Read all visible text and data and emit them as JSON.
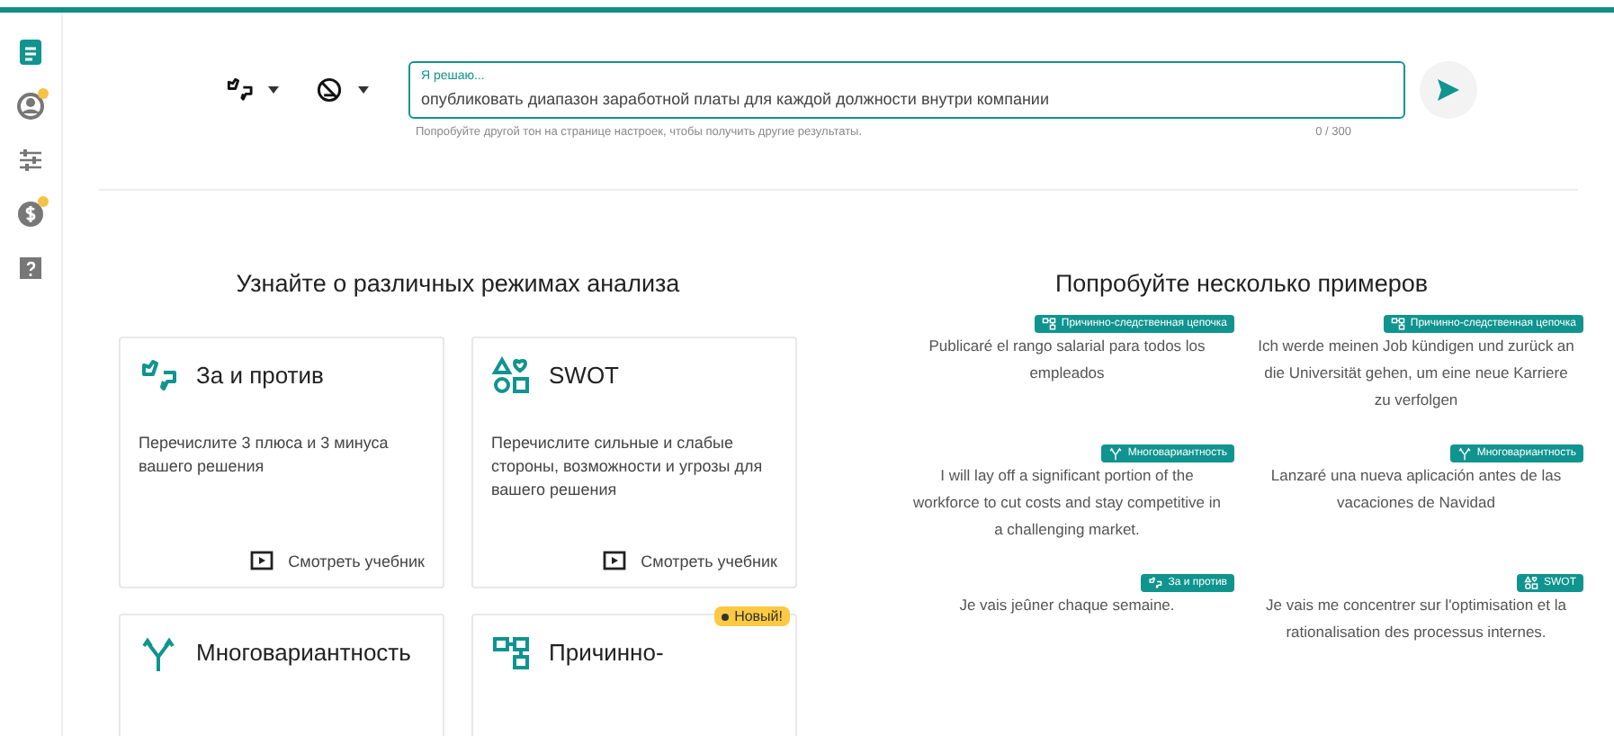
{
  "sidebar": {
    "items": [
      {
        "kind": "document",
        "selected": true,
        "alert": false
      },
      {
        "kind": "person",
        "selected": false,
        "alert": true
      },
      {
        "kind": "sliders",
        "selected": false,
        "alert": false
      },
      {
        "kind": "dollar",
        "selected": false,
        "alert": true
      },
      {
        "kind": "help",
        "selected": false,
        "alert": false
      }
    ]
  },
  "toolbar": {
    "selectors": [
      {
        "kind": "pros-cons"
      },
      {
        "kind": "tone"
      }
    ]
  },
  "decision_field": {
    "label": "Я решаю...",
    "value": "опубликовать диапазон заработной платы для каждой должности внутри компании",
    "hint": "Попробуйте другой тон на странице настроек, чтобы получить другие результаты.",
    "counter": "0 / 300"
  },
  "modes": {
    "title": "Узнайте о различных режимах анализа",
    "cards": [
      {
        "kind": "pros-cons",
        "title": "За и против",
        "description": "Перечислите 3 плюса и 3 минуса вашего решения",
        "tutorial_link": "Смотреть учебник"
      },
      {
        "kind": "swot",
        "title": "SWOT",
        "description": "Перечислите сильные и слабые стороны, возможности и угрозы для вашего решения",
        "tutorial_link": "Смотреть учебник"
      },
      {
        "kind": "multi",
        "title": "Многовариантность"
      },
      {
        "kind": "causal",
        "title": "Причинно-",
        "badge": "Новый!"
      }
    ]
  },
  "examples": {
    "title": "Попробуйте несколько примеров",
    "items": [
      {
        "tag": {
          "kind": "causal",
          "label": "Причинно-следственная цепочка"
        },
        "text": "Publicaré el rango salarial para todos los empleados"
      },
      {
        "tag": {
          "kind": "causal",
          "label": "Причинно-следственная цепочка"
        },
        "text": "Ich werde meinen Job kündigen und zurück an die Universität gehen, um eine neue Karriere zu verfolgen"
      },
      {
        "tag": {
          "kind": "multi",
          "label": "Многовариантность"
        },
        "text": "I will lay off a significant portion of the workforce to cut costs and stay competitive in a challenging market."
      },
      {
        "tag": {
          "kind": "multi",
          "label": "Многовариантность"
        },
        "text": "Lanzaré una nueva aplicación antes de las vacaciones de Navidad"
      },
      {
        "tag": {
          "kind": "pros-cons",
          "label": "За и против"
        },
        "text": "Je vais jeûner chaque semaine."
      },
      {
        "tag": {
          "kind": "swot",
          "label": "SWOT"
        },
        "text": "Je vais me concentrer sur l'optimisation et la rationalisation des processus internes."
      }
    ]
  }
}
